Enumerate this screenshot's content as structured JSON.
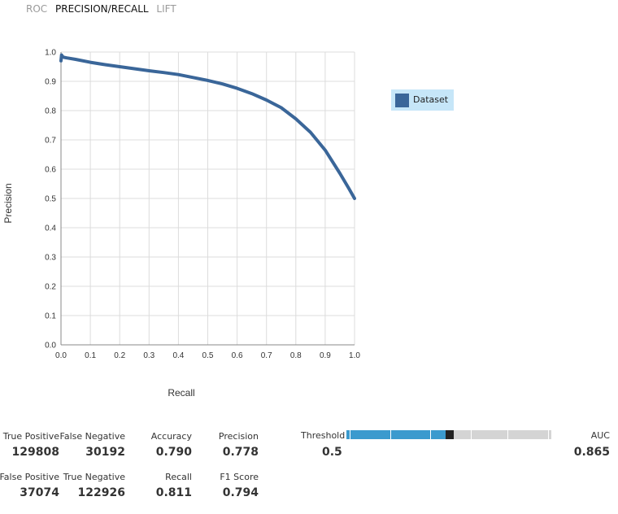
{
  "tabs": [
    {
      "label": "ROC",
      "active": false
    },
    {
      "label": "PRECISION/RECALL",
      "active": true
    },
    {
      "label": "LIFT",
      "active": false
    }
  ],
  "chart_data": {
    "type": "line",
    "xlabel": "Recall",
    "ylabel": "Precision",
    "xlim": [
      0,
      1
    ],
    "ylim": [
      0,
      1
    ],
    "xticks": [
      "0.0",
      "0.1",
      "0.2",
      "0.3",
      "0.4",
      "0.5",
      "0.6",
      "0.7",
      "0.8",
      "0.9",
      "1.0"
    ],
    "yticks": [
      "0.0",
      "0.1",
      "0.2",
      "0.3",
      "0.4",
      "0.5",
      "0.6",
      "0.7",
      "0.8",
      "0.9",
      "1.0"
    ],
    "grid": true,
    "legend_position": "right",
    "series": [
      {
        "name": "Dataset",
        "color": "#3a6699",
        "x": [
          0.0,
          0.002,
          0.005,
          0.01,
          0.02,
          0.05,
          0.1,
          0.15,
          0.2,
          0.25,
          0.3,
          0.35,
          0.4,
          0.45,
          0.5,
          0.55,
          0.6,
          0.65,
          0.7,
          0.75,
          0.8,
          0.85,
          0.9,
          0.95,
          0.98,
          1.0
        ],
        "y": [
          0.97,
          0.99,
          0.985,
          0.982,
          0.98,
          0.975,
          0.965,
          0.957,
          0.95,
          0.943,
          0.936,
          0.93,
          0.923,
          0.913,
          0.903,
          0.891,
          0.876,
          0.858,
          0.836,
          0.81,
          0.772,
          0.726,
          0.665,
          0.586,
          0.535,
          0.5
        ]
      }
    ]
  },
  "metrics": {
    "true_positive": {
      "label": "True Positive",
      "value": "129808"
    },
    "false_negative": {
      "label": "False Negative",
      "value": "30192"
    },
    "accuracy": {
      "label": "Accuracy",
      "value": "0.790"
    },
    "precision": {
      "label": "Precision",
      "value": "0.778"
    },
    "false_positive": {
      "label": "False Positive",
      "value": "37074"
    },
    "true_negative": {
      "label": "True Negative",
      "value": "122926"
    },
    "recall": {
      "label": "Recall",
      "value": "0.811"
    },
    "f1_score": {
      "label": "F1 Score",
      "value": "0.794"
    },
    "threshold": {
      "label": "Threshold",
      "value": "0.5",
      "slider_position": 0.5
    },
    "auc": {
      "label": "AUC",
      "value": "0.865"
    }
  }
}
